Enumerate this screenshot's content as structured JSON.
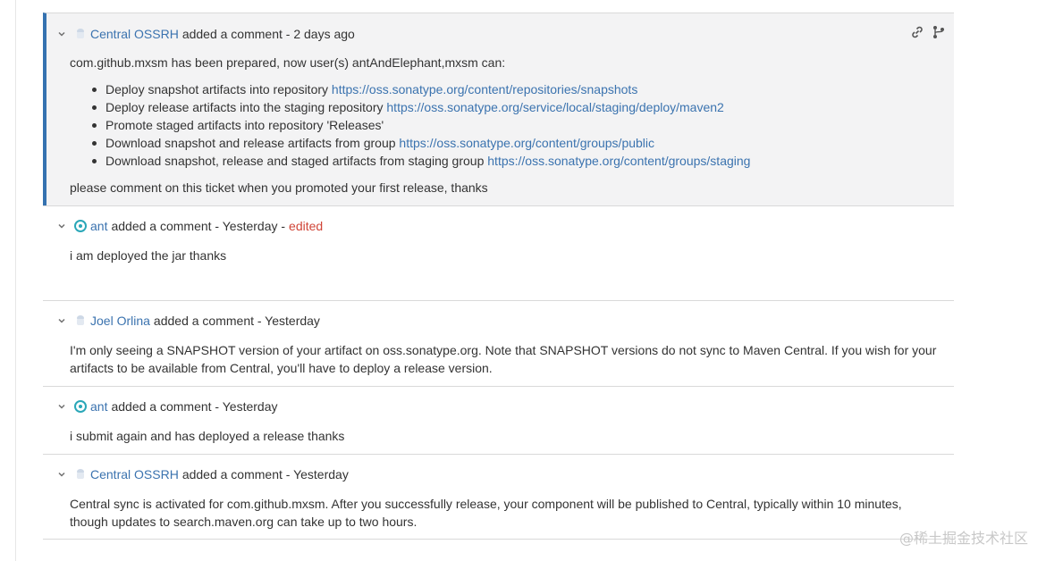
{
  "comments": [
    {
      "author": "Central OSSRH",
      "action": "added a comment - 2 days ago",
      "intro": "com.github.mxsm has been prepared, now user(s) antAndElephant,mxsm can:",
      "bullets": [
        {
          "text": "Deploy snapshot artifacts into repository ",
          "link": "https://oss.sonatype.org/content/repositories/snapshots"
        },
        {
          "text": "Deploy release artifacts into the staging repository ",
          "link": "https://oss.sonatype.org/service/local/staging/deploy/maven2"
        },
        {
          "text": "Promote staged artifacts into repository 'Releases'",
          "link": ""
        },
        {
          "text": "Download snapshot and release artifacts from group ",
          "link": "https://oss.sonatype.org/content/groups/public"
        },
        {
          "text": "Download snapshot, release and staged artifacts from staging group ",
          "link": "https://oss.sonatype.org/content/groups/staging"
        }
      ],
      "outro": "please comment on this ticket when you promoted your first release, thanks"
    },
    {
      "author": "ant",
      "action": "added a comment - Yesterday -",
      "edited": "edited",
      "body": "i am deployed the jar  thanks"
    },
    {
      "author": "Joel Orlina",
      "action": "added a comment - Yesterday",
      "body": "I'm only seeing a SNAPSHOT version of your artifact on oss.sonatype.org. Note that SNAPSHOT versions do not sync to Maven Central. If you wish for your artifacts to be available from Central, you'll have to deploy a release version."
    },
    {
      "author": "ant",
      "action": "added a comment - Yesterday",
      "body": "i submit again  and  has  deployed a release thanks"
    },
    {
      "author": "Central OSSRH",
      "action": "added a comment - Yesterday",
      "body": "Central sync is activated for com.github.mxsm. After you successfully release, your component will be published to Central, typically within 10 minutes, though updates to search.maven.org can take up to two hours."
    }
  ],
  "watermark": "@稀土掘金技术社区",
  "colors": {
    "link": "#3b73af",
    "focus_bar": "#3572b0",
    "edited": "#d04437",
    "focused_bg": "#f3f3f4"
  },
  "icons": {
    "chevron": "chevron-down-icon",
    "avatar_default": "default-avatar-icon",
    "avatar_ant": "ant-avatar-icon",
    "permalink": "link-icon",
    "branch": "branch-icon"
  }
}
